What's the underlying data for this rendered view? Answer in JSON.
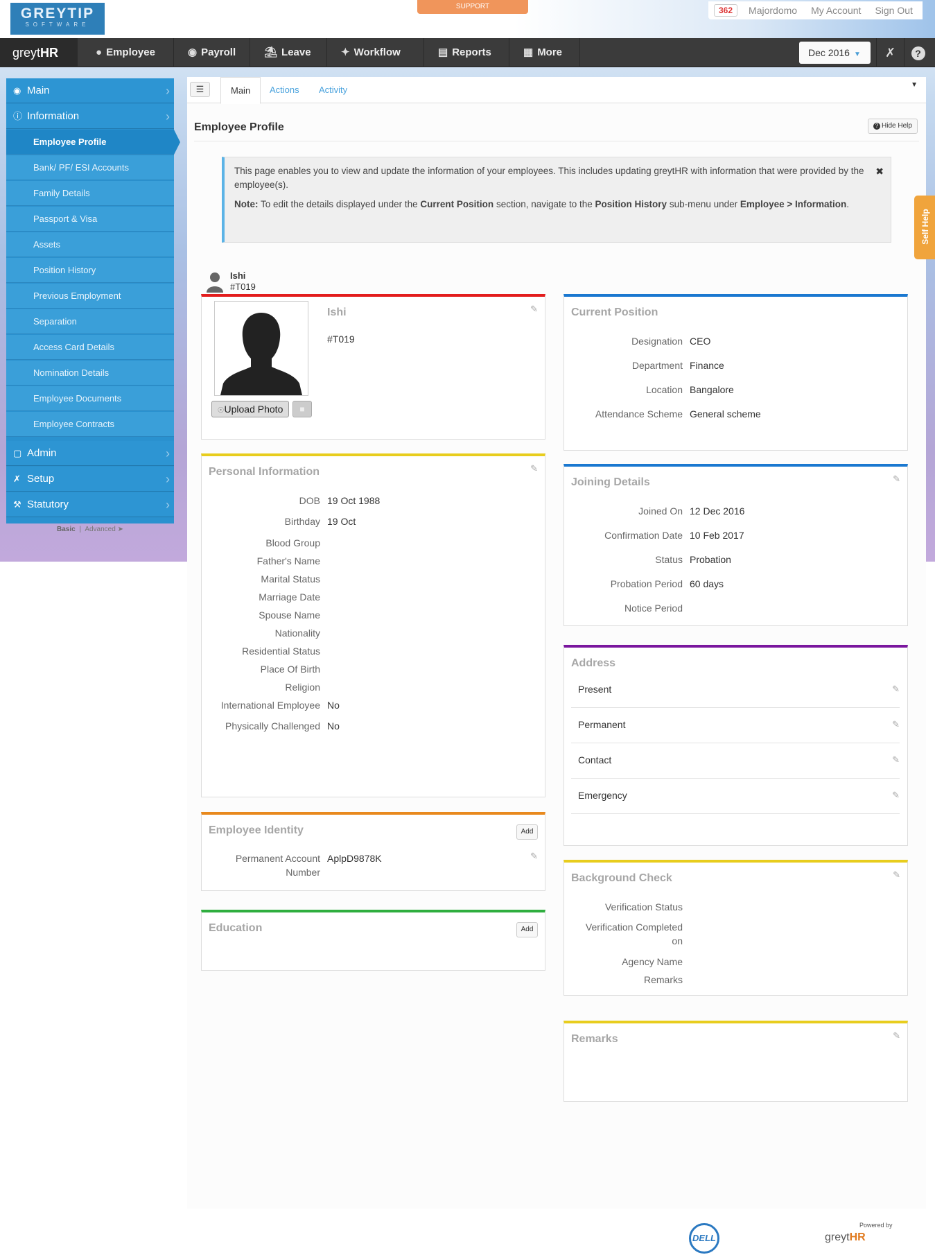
{
  "header": {
    "logo_main": "GREYTIP",
    "logo_sub": "SOFTWARE",
    "support_label": "SUPPORT",
    "notification_count": "362",
    "user_links": [
      "Majordomo",
      "My Account",
      "Sign Out"
    ]
  },
  "navbar": {
    "brand_prefix": "greyt",
    "brand_suffix": "HR",
    "items": [
      "Employee",
      "Payroll",
      "Leave",
      "Workflow",
      "Reports",
      "More"
    ],
    "period": "Dec 2016"
  },
  "sidebar": {
    "main_items": [
      "Main",
      "Information",
      "Admin",
      "Setup",
      "Statutory"
    ],
    "sub_items": [
      "Employee Profile",
      "Bank/ PF/ ESI Accounts",
      "Family Details",
      "Passport & Visa",
      "Assets",
      "Position History",
      "Previous Employment",
      "Separation",
      "Access Card Details",
      "Nomination Details",
      "Employee Documents",
      "Employee Contracts"
    ],
    "footer_basic": "Basic",
    "footer_sep": "|",
    "footer_advanced": "Advanced"
  },
  "tabs": [
    "Main",
    "Actions",
    "Activity"
  ],
  "page": {
    "title": "Employee Profile",
    "hide_help": "Hide Help",
    "help_text": "This page enables you to view and update the information of your employees. This includes updating greytHR with information that were provided by the employee(s).",
    "note_label": "Note:",
    "note_a": " To edit the details displayed under the ",
    "note_b": "Current Position",
    "note_c": " section, navigate to the ",
    "note_d": "Position History",
    "note_e": " sub-menu under ",
    "note_f": "Employee > Information",
    "note_g": "."
  },
  "employee": {
    "name": "Ishi",
    "id": "#T019",
    "upload_label": "Upload Photo"
  },
  "personal": {
    "title": "Personal Information",
    "fields": [
      {
        "label": "DOB",
        "value": "19 Oct 1988"
      },
      {
        "label": "Birthday",
        "value": "19 Oct"
      },
      {
        "label": "Blood Group",
        "value": ""
      },
      {
        "label": "Father's Name",
        "value": ""
      },
      {
        "label": "Marital Status",
        "value": ""
      },
      {
        "label": "Marriage Date",
        "value": ""
      },
      {
        "label": "Spouse Name",
        "value": ""
      },
      {
        "label": "Nationality",
        "value": ""
      },
      {
        "label": "Residential Status",
        "value": ""
      },
      {
        "label": "Place Of Birth",
        "value": ""
      },
      {
        "label": "Religion",
        "value": ""
      },
      {
        "label": "International Employee",
        "value": "No"
      },
      {
        "label": "Physically Challenged",
        "value": "No"
      }
    ]
  },
  "identity": {
    "title": "Employee Identity",
    "add_label": "Add",
    "label_line1": "Permanent Account",
    "label_line2": "Number",
    "value": "AplpD9878K"
  },
  "education": {
    "title": "Education",
    "add_label": "Add"
  },
  "current_position": {
    "title": "Current Position",
    "fields": [
      {
        "label": "Designation",
        "value": "CEO"
      },
      {
        "label": "Department",
        "value": "Finance"
      },
      {
        "label": "Location",
        "value": "Bangalore"
      },
      {
        "label": "Attendance Scheme",
        "value": "General scheme"
      }
    ]
  },
  "joining": {
    "title": "Joining Details",
    "fields": [
      {
        "label": "Joined On",
        "value": "12 Dec 2016"
      },
      {
        "label": "Confirmation Date",
        "value": "10 Feb 2017"
      },
      {
        "label": "Status",
        "value": "Probation"
      },
      {
        "label": "Probation Period",
        "value": "60 days"
      },
      {
        "label": "Notice Period",
        "value": ""
      }
    ]
  },
  "address": {
    "title": "Address",
    "rows": [
      "Present",
      "Permanent",
      "Contact",
      "Emergency"
    ]
  },
  "background": {
    "title": "Background Check",
    "labels": [
      "Verification Status",
      "Verification Completed",
      "on",
      "Agency Name",
      "Remarks"
    ]
  },
  "remarks": {
    "title": "Remarks"
  },
  "self_help": "Self Help",
  "footer": {
    "dell": "DELL",
    "powered_by": "Powered by",
    "brand_prefix": "greyt",
    "brand_suffix": "HR"
  },
  "colors": {
    "red": "#e31d1d",
    "yellow": "#e8cd1d",
    "orange": "#e8891d",
    "green": "#2fae3f",
    "blue": "#1a78d0",
    "purple": "#7a169e",
    "sidebar": "#2a91cf"
  }
}
